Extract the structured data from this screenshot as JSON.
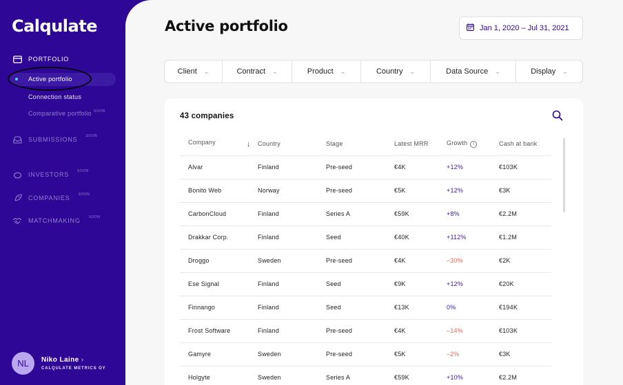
{
  "app": {
    "logo": "Calqulate"
  },
  "sidebar": {
    "sections": [
      {
        "label": "PORTFOLIO",
        "soon": "",
        "icon": "portfolio-icon"
      },
      {
        "label": "SUBMISSIONS",
        "soon": "SOON",
        "icon": "inbox-icon"
      },
      {
        "label": "INVESTORS",
        "soon": "SOON",
        "icon": "piggy-bank-icon"
      },
      {
        "label": "COMPANIES",
        "soon": "SOON",
        "icon": "rocket-icon"
      },
      {
        "label": "MATCHMAKING",
        "soon": "SOON",
        "icon": "handshake-icon"
      }
    ],
    "portfolio_items": [
      {
        "label": "Active portfolio",
        "soon": ""
      },
      {
        "label": "Connection status",
        "soon": ""
      },
      {
        "label": "Comparative portfolio",
        "soon": "SOON"
      }
    ],
    "user": {
      "initials": "NL",
      "name": "Niko Laine",
      "company": "CALQULATE METRICS OY"
    }
  },
  "header": {
    "title": "Active portfolio",
    "date_range": "Jan 1, 2020 – Jul 31, 2021"
  },
  "filters": [
    "Client",
    "Contract",
    "Product",
    "Country",
    "Data Source",
    "Display"
  ],
  "table": {
    "count_label": "43 companies",
    "columns": [
      "Company",
      "Country",
      "Stage",
      "Latest MRR",
      "Growth",
      "Cash at bank"
    ],
    "rows": [
      [
        "Alvar",
        "Finland",
        "Pre-seed",
        "€4K",
        "+12%",
        "€103K"
      ],
      [
        "Bonito Web",
        "Norway",
        "Pre-seed",
        "€5K",
        "+12%",
        "€3K"
      ],
      [
        "CarbonCloud",
        "Finland",
        "Series A",
        "€59K",
        "+8%",
        "€2.2M"
      ],
      [
        "Drakkar Corp.",
        "Finland",
        "Seed",
        "€40K",
        "+112%",
        "€1.2M"
      ],
      [
        "Droggo",
        "Sweden",
        "Pre-seed",
        "€4K",
        "–30%",
        "€2K"
      ],
      [
        "Ese Signal",
        "Finland",
        "Seed",
        "€9K",
        "+12%",
        "€20K"
      ],
      [
        "Finnango",
        "Finland",
        "Seed",
        "€13K",
        "0%",
        "€194K"
      ],
      [
        "Frost Software",
        "Finland",
        "Pre-seed",
        "€4K",
        "–14%",
        "€103K"
      ],
      [
        "Gamyre",
        "Sweden",
        "Pre-seed",
        "€5K",
        "–2%",
        "€3K"
      ],
      [
        "Holgyte",
        "Sweden",
        "Series A",
        "€59K",
        "+10%",
        "€2.2M"
      ]
    ]
  },
  "colors": {
    "sidebar": "#2f0796",
    "positive": "#3a1aa5",
    "negative": "#e36b5a",
    "active_dot": "#55d6ff"
  }
}
